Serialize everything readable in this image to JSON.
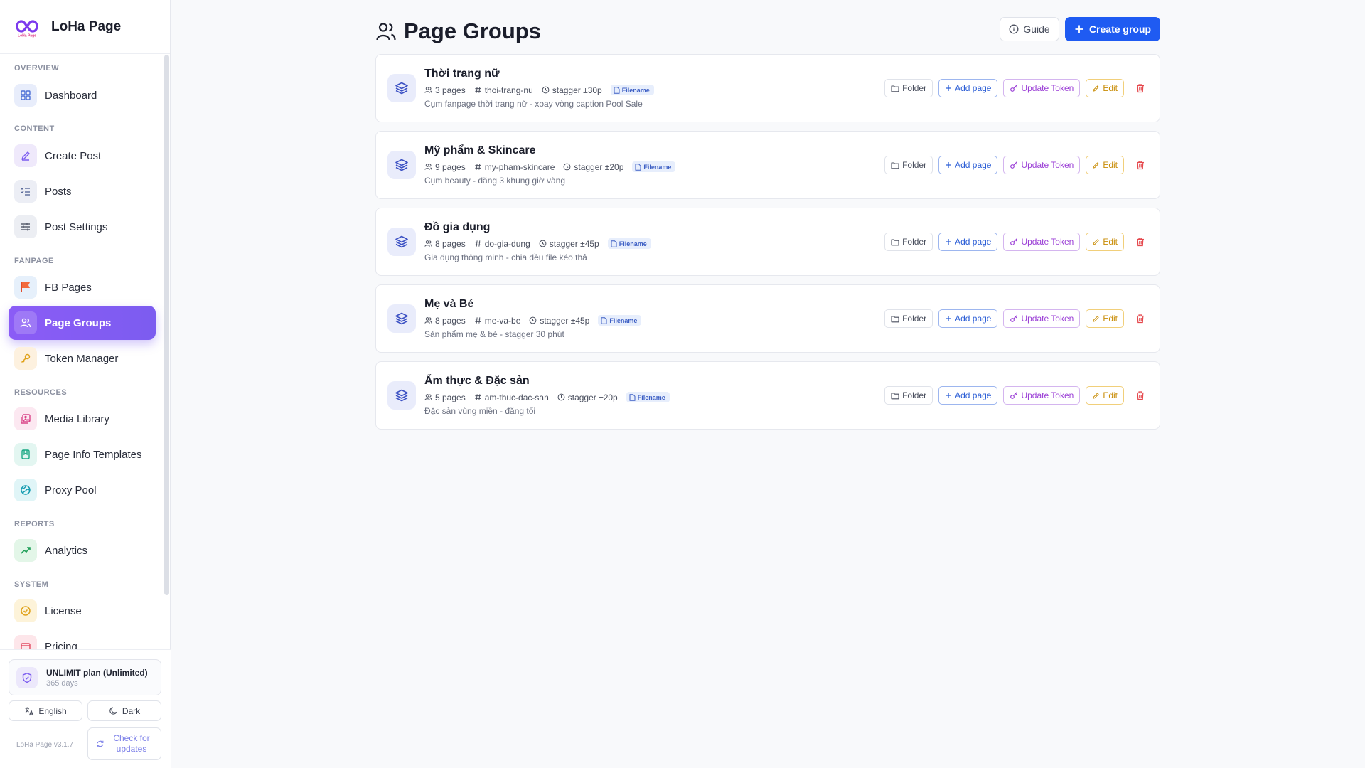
{
  "app": {
    "name": "LoHa Page",
    "version": "LoHa Page v3.1.7"
  },
  "sidebar": {
    "sections": [
      {
        "label": "OVERVIEW",
        "items": [
          {
            "label": "Dashboard",
            "icon": "grid-icon"
          }
        ]
      },
      {
        "label": "CONTENT",
        "items": [
          {
            "label": "Create Post",
            "icon": "pen-icon"
          },
          {
            "label": "Posts",
            "icon": "list-icon"
          },
          {
            "label": "Post Settings",
            "icon": "sliders-icon"
          }
        ]
      },
      {
        "label": "FANPAGE",
        "items": [
          {
            "label": "FB Pages",
            "icon": "flag-icon"
          },
          {
            "label": "Page Groups",
            "icon": "users-icon",
            "active": true
          },
          {
            "label": "Token Manager",
            "icon": "key-icon"
          }
        ]
      },
      {
        "label": "RESOURCES",
        "items": [
          {
            "label": "Media Library",
            "icon": "images-icon"
          },
          {
            "label": "Page Info Templates",
            "icon": "bookmark-icon"
          },
          {
            "label": "Proxy Pool",
            "icon": "globe-icon"
          }
        ]
      },
      {
        "label": "REPORTS",
        "items": [
          {
            "label": "Analytics",
            "icon": "trend-up-icon"
          }
        ]
      },
      {
        "label": "SYSTEM",
        "items": [
          {
            "label": "License",
            "icon": "check-circle-icon"
          },
          {
            "label": "Pricing",
            "icon": "card-icon"
          }
        ]
      }
    ],
    "footer": {
      "plan_title": "UNLIMIT plan (Unlimited)",
      "plan_sub": "365 days",
      "language": "English",
      "theme": "Dark",
      "check_updates": "Check for updates"
    }
  },
  "header": {
    "title": "Page Groups",
    "guide": "Guide",
    "create": "Create group"
  },
  "groups": [
    {
      "name": "Thời trang nữ",
      "pages": "3 pages",
      "slug": "thoi-trang-nu",
      "stagger": "stagger ±30p",
      "badge": "Filename",
      "desc": "Cụm fanpage thời trang nữ - xoay vòng caption Pool Sale"
    },
    {
      "name": "Mỹ phẩm & Skincare",
      "pages": "9 pages",
      "slug": "my-pham-skincare",
      "stagger": "stagger ±20p",
      "badge": "Filename",
      "desc": "Cụm beauty - đăng 3 khung giờ vàng"
    },
    {
      "name": "Đồ gia dụng",
      "pages": "8 pages",
      "slug": "do-gia-dung",
      "stagger": "stagger ±45p",
      "badge": "Filename",
      "desc": "Gia dụng thông minh - chia đều file kéo thả"
    },
    {
      "name": "Mẹ và Bé",
      "pages": "8 pages",
      "slug": "me-va-be",
      "stagger": "stagger ±45p",
      "badge": "Filename",
      "desc": "Sản phẩm mẹ & bé - stagger 30 phút"
    },
    {
      "name": "Ẩm thực & Đặc sản",
      "pages": "5 pages",
      "slug": "am-thuc-dac-san",
      "stagger": "stagger ±20p",
      "badge": "Filename",
      "desc": "Đặc sản vùng miền - đăng tối"
    }
  ],
  "actions": {
    "folder": "Folder",
    "add_page": "Add page",
    "update_token": "Update Token",
    "edit": "Edit"
  },
  "colors": {
    "accent": "#8b5cf6",
    "primary": "#1f5bf2",
    "delete": "#e5484d"
  }
}
